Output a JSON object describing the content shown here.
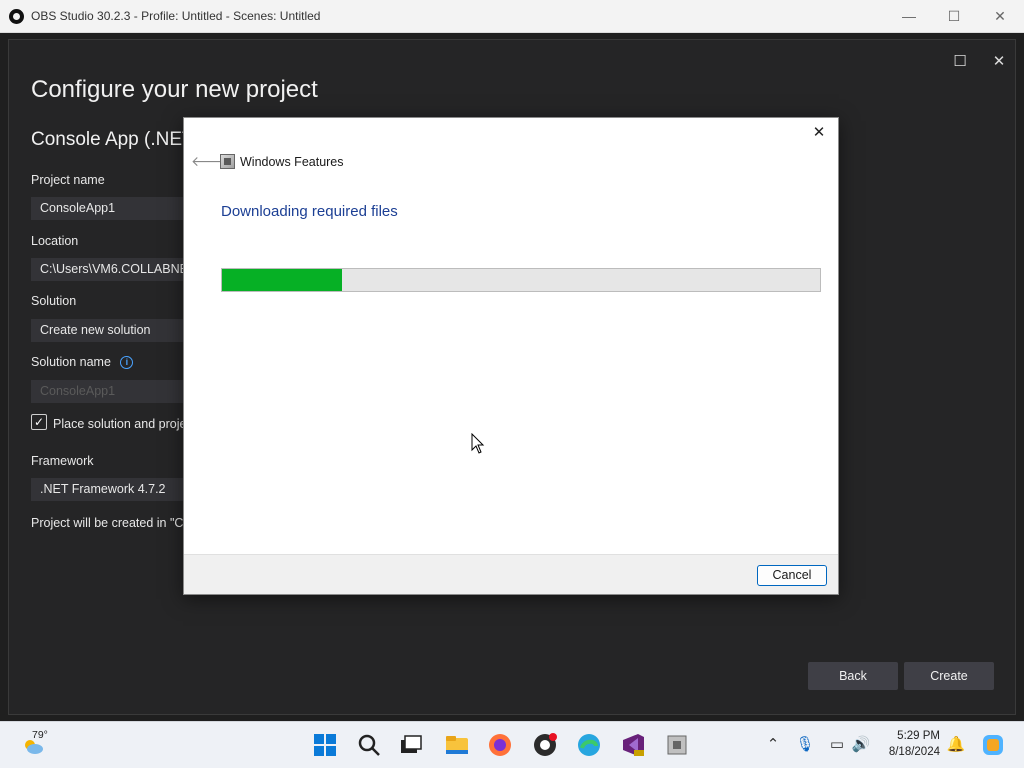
{
  "obs": {
    "title": "OBS Studio 30.2.3 - Profile: Untitled - Scenes: Untitled"
  },
  "vs_dialog": {
    "title": "Configure your new project",
    "subtitle": "Console App (.NET",
    "project_name_label": "Project name",
    "project_name_value": "ConsoleApp1",
    "location_label": "Location",
    "location_value": "C:\\Users\\VM6.COLLABNET\\",
    "solution_label": "Solution",
    "solution_value": "Create new solution",
    "solution_name_label": "Solution name",
    "solution_name_value": "ConsoleApp1",
    "place_solution_label": "Place solution and projec",
    "place_solution_checked": true,
    "framework_label": "Framework",
    "framework_value": ".NET Framework 4.7.2",
    "created_in_text": "Project will be created in \"C:\\",
    "back_label": "Back",
    "create_label": "Create"
  },
  "windows_features": {
    "title": "Windows Features",
    "heading": "Downloading required files",
    "progress": 0.2,
    "progress_color": "#06b025",
    "cancel_label": "Cancel"
  },
  "taskbar": {
    "weather_temp": "79°",
    "time": "5:29 PM",
    "date": "8/18/2024",
    "pinned_icons": [
      "windows-start-icon",
      "search-icon",
      "task-view-icon",
      "file-explorer-icon",
      "firefox-icon",
      "obs-icon",
      "edge-icon",
      "visual-studio-icon",
      "windows-features-icon"
    ],
    "tray_icons": [
      "chevron-up-icon",
      "microphone-icon",
      "network-icon",
      "volume-icon",
      "notification-bell-icon",
      "copilot-icon"
    ]
  }
}
